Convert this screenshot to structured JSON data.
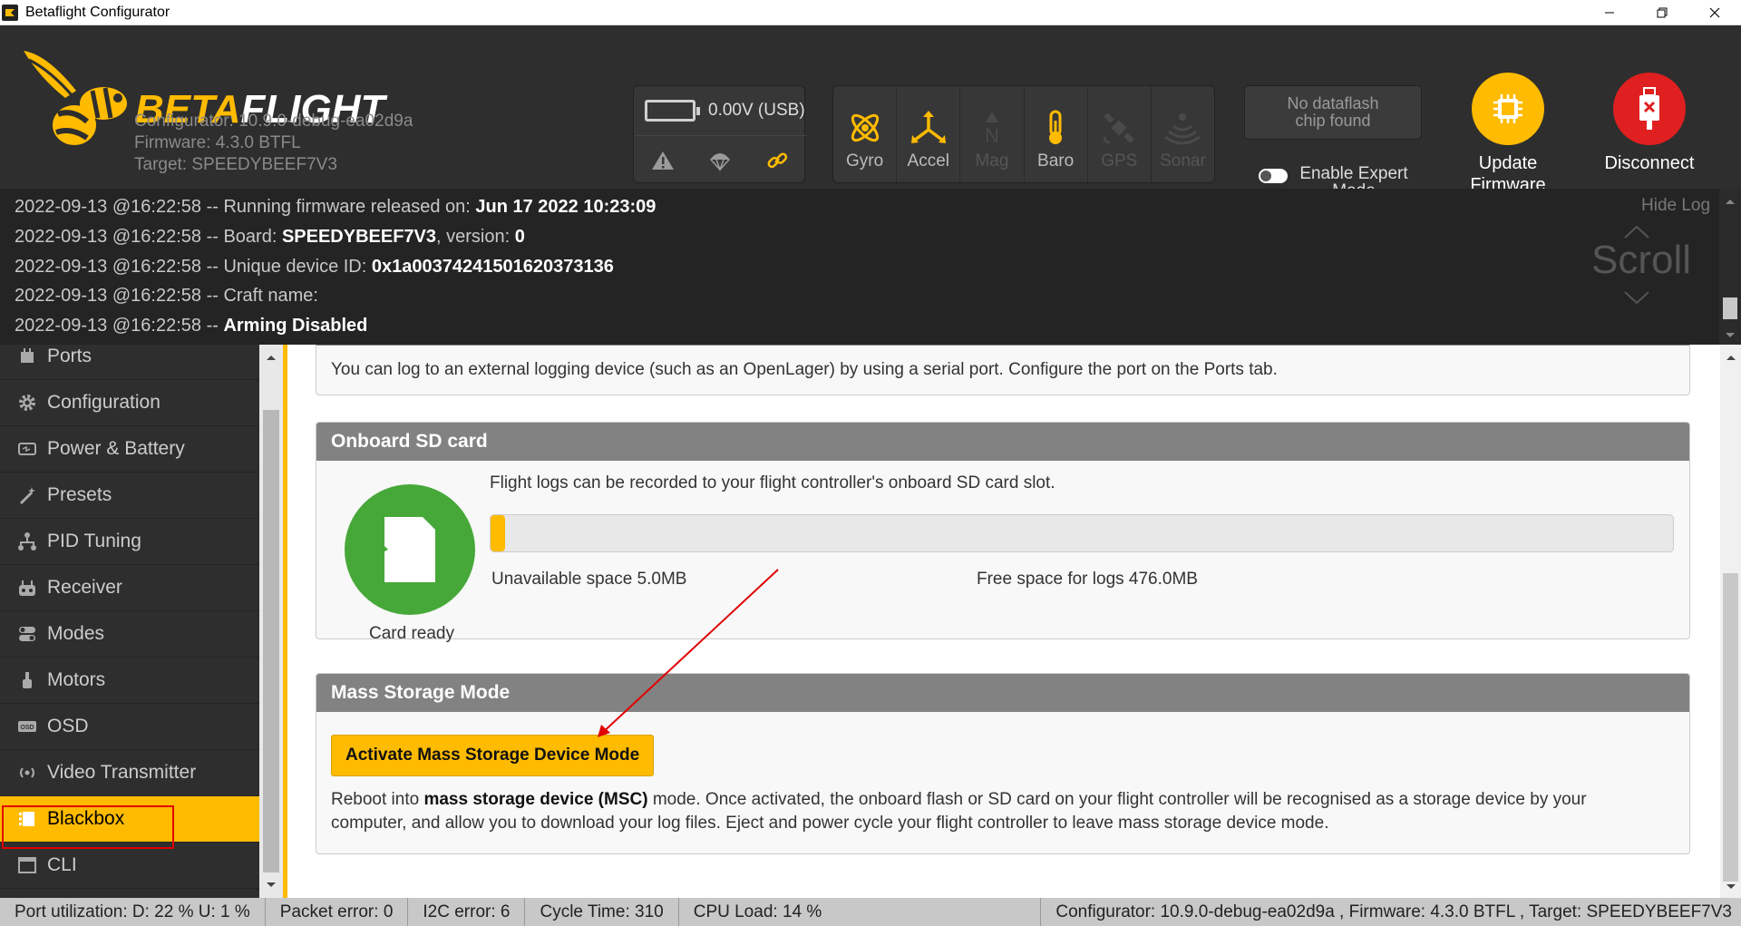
{
  "window": {
    "title": "Betaflight Configurator"
  },
  "header": {
    "brand_a": "BETA",
    "brand_b": "FLIGHT",
    "configurator": "Configurator: 10.9.0-debug-ea02d9a",
    "firmware": "Firmware: 4.3.0 BTFL",
    "target": "Target: SPEEDYBEEF7V3",
    "battery": "0.00V (USB)",
    "sensors": [
      {
        "label": "Gyro",
        "icon": "gyro-icon",
        "active": true
      },
      {
        "label": "Accel",
        "icon": "accel-icon",
        "active": true
      },
      {
        "label": "Mag",
        "icon": "mag-icon",
        "active": false
      },
      {
        "label": "Baro",
        "icon": "baro-icon",
        "active": true
      },
      {
        "label": "GPS",
        "icon": "gps-icon",
        "active": false
      },
      {
        "label": "Sonar",
        "icon": "sonar-icon",
        "active": false
      }
    ],
    "dataflash_line1": "No dataflash",
    "dataflash_line2": "chip found",
    "expert_mode": "Enable Expert Mode",
    "update_firmware": "Update Firmware",
    "disconnect": "Disconnect"
  },
  "log": {
    "hide_log": "Hide Log",
    "scroll": "Scroll",
    "lines": [
      {
        "prefix": "2022-09-13 @16:22:58 -- Running firmware released on: ",
        "bold": "Jun 17 2022 10:23:09",
        "suffix": ""
      },
      {
        "prefix": "2022-09-13 @16:22:58 -- Board: ",
        "bold": "SPEEDYBEEF7V3",
        "suffix": ", version: ",
        "bold2": "0"
      },
      {
        "prefix": "2022-09-13 @16:22:58 -- Unique device ID: ",
        "bold": "0x1a00374241501620373136",
        "suffix": ""
      },
      {
        "prefix": "2022-09-13 @16:22:58 -- Craft name:",
        "bold": "",
        "suffix": ""
      },
      {
        "prefix": "2022-09-13 @16:22:58 -- ",
        "bold": "Arming Disabled",
        "suffix": ""
      }
    ]
  },
  "sidebar": {
    "items": [
      {
        "label": "Ports",
        "icon": "ports-icon"
      },
      {
        "label": "Configuration",
        "icon": "gear-icon"
      },
      {
        "label": "Power & Battery",
        "icon": "battery-icon"
      },
      {
        "label": "Presets",
        "icon": "wand-icon"
      },
      {
        "label": "PID Tuning",
        "icon": "pid-icon"
      },
      {
        "label": "Receiver",
        "icon": "receiver-icon"
      },
      {
        "label": "Modes",
        "icon": "modes-icon"
      },
      {
        "label": "Motors",
        "icon": "motor-icon"
      },
      {
        "label": "OSD",
        "icon": "osd-icon"
      },
      {
        "label": "Video Transmitter",
        "icon": "vtx-icon"
      },
      {
        "label": "Blackbox",
        "icon": "blackbox-icon",
        "active": true
      },
      {
        "label": "CLI",
        "icon": "cli-icon"
      }
    ]
  },
  "main": {
    "serial_text": "You can log to an external logging device (such as an OpenLager) by using a serial port. Configure the port on the Ports tab.",
    "sd": {
      "title": "Onboard SD card",
      "desc": "Flight logs can be recorded to your flight controller's onboard SD card slot.",
      "status": "Card ready",
      "unavailable": "Unavailable space 5.0MB",
      "free": "Free space for logs 476.0MB",
      "used_fraction": 0.0104
    },
    "msc": {
      "title": "Mass Storage Mode",
      "button": "Activate Mass Storage Device Mode",
      "desc_a": "Reboot into ",
      "desc_bold": "mass storage device (MSC)",
      "desc_b": " mode. Once activated, the onboard flash or SD card on your flight controller will be recognised as a storage device by your computer, and allow you to download your log files. Eject and power cycle your flight controller to leave mass storage device mode."
    }
  },
  "status": {
    "port": "Port utilization: D: 22 % U: 1 %",
    "packet": "Packet error: 0",
    "i2c": "I2C error: 6",
    "cycle": "Cycle Time: 310",
    "cpu": "CPU Load: 14 %",
    "version": "Configurator: 10.9.0-debug-ea02d9a , Firmware: 4.3.0 BTFL , Target: SPEEDYBEEF7V3"
  },
  "colors": {
    "accent": "#ffbb00",
    "disconnect": "#e02020",
    "sd_ready": "#47a83a",
    "annotation": "#e00000"
  }
}
